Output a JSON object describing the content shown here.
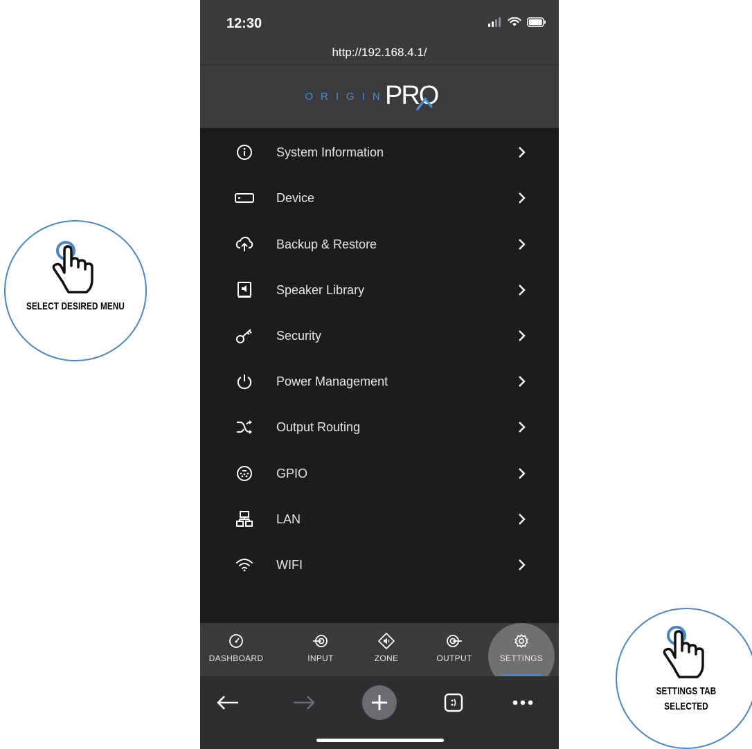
{
  "status_bar": {
    "time": "12:30"
  },
  "browser": {
    "url": "http://192.168.4.1/"
  },
  "logo": {
    "origin_text": "ORIGIN",
    "pro_text": "PRO"
  },
  "menu": {
    "items": [
      {
        "label": "System Information",
        "icon": "info-icon"
      },
      {
        "label": "Device",
        "icon": "device-icon"
      },
      {
        "label": "Backup & Restore",
        "icon": "cloud-upload-icon"
      },
      {
        "label": "Speaker Library",
        "icon": "speaker-library-icon"
      },
      {
        "label": "Security",
        "icon": "key-icon"
      },
      {
        "label": "Power Management",
        "icon": "power-icon"
      },
      {
        "label": "Output Routing",
        "icon": "shuffle-icon"
      },
      {
        "label": "GPIO",
        "icon": "gpio-icon"
      },
      {
        "label": "LAN",
        "icon": "network-icon"
      },
      {
        "label": "WIFI",
        "icon": "wifi-icon"
      }
    ]
  },
  "tabs": {
    "items": [
      {
        "label": "DASHBOARD",
        "icon": "gauge-icon"
      },
      {
        "label": "INPUT",
        "icon": "input-icon"
      },
      {
        "label": "ZONE",
        "icon": "zone-icon"
      },
      {
        "label": "OUTPUT",
        "icon": "output-icon"
      },
      {
        "label": "SETTINGS",
        "icon": "gear-icon"
      }
    ],
    "selected": "SETTINGS",
    "accent_color": "#4a90d9"
  },
  "callouts": {
    "left": "SELECT DESIRED MENU",
    "right": "SETTINGS TAB SELECTED"
  }
}
